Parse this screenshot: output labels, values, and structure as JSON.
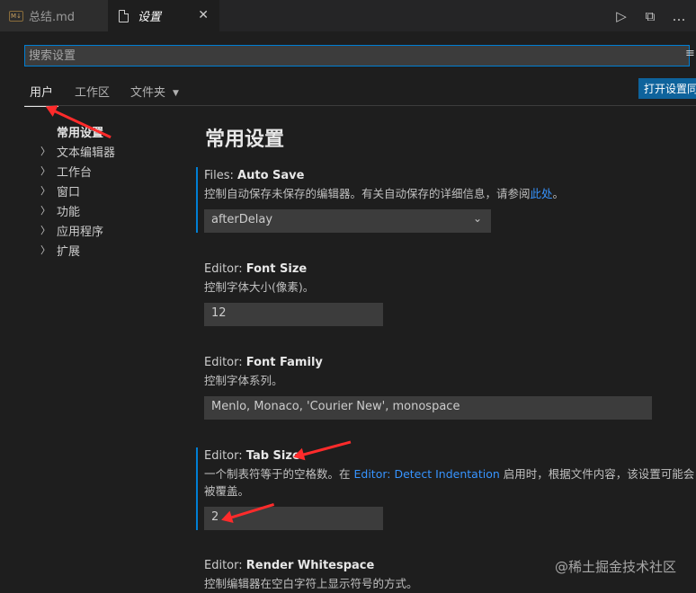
{
  "tabs": [
    {
      "label": "总结.md",
      "icon": "markdown-icon",
      "icon_text": "M↓"
    },
    {
      "label": "设置",
      "icon": "document-icon",
      "close": "✕"
    }
  ],
  "toolbar": {
    "run": "▷",
    "split": "⧉",
    "more": "…"
  },
  "search": {
    "placeholder": "搜索设置"
  },
  "more_button": "≡",
  "setting_tabs": [
    "用户",
    "工作区",
    "文件夹"
  ],
  "json_button": "打开设置同",
  "toc": {
    "header": "常用设置",
    "items": [
      "文本编辑器",
      "工作台",
      "窗口",
      "功能",
      "应用程序",
      "扩展"
    ]
  },
  "main": {
    "title": "常用设置",
    "auto_save": {
      "category": "Files: ",
      "name": "Auto Save",
      "desc": "控制自动保存未保存的编辑器。有关自动保存的详细信息，请参阅",
      "link": "此处",
      "desc_end": "。",
      "value": "afterDelay"
    },
    "font_size": {
      "category": "Editor: ",
      "name": "Font Size",
      "desc": "控制字体大小(像素)。",
      "value": "12"
    },
    "font_family": {
      "category": "Editor: ",
      "name": "Font Family",
      "desc": "控制字体系列。",
      "value": "Menlo, Monaco, 'Courier New', monospace"
    },
    "tab_size": {
      "category": "Editor: ",
      "name": "Tab Size",
      "desc_start": "一个制表符等于的空格数。在 ",
      "link": "Editor: Detect Indentation",
      "desc_mid": " 启用时，根据文件内容，该设置可能会",
      "desc_end": "被覆盖。",
      "value": "2"
    },
    "render_ws": {
      "category": "Editor: ",
      "name": "Render Whitespace",
      "desc": "控制编辑器在空白字符上显示符号的方式。"
    }
  },
  "watermark": "@稀土掘金技术社区",
  "colors": {
    "accent": "#007fd4",
    "button": "#0e639c",
    "link": "#3794ff",
    "annotation": "#ff2b2b"
  }
}
